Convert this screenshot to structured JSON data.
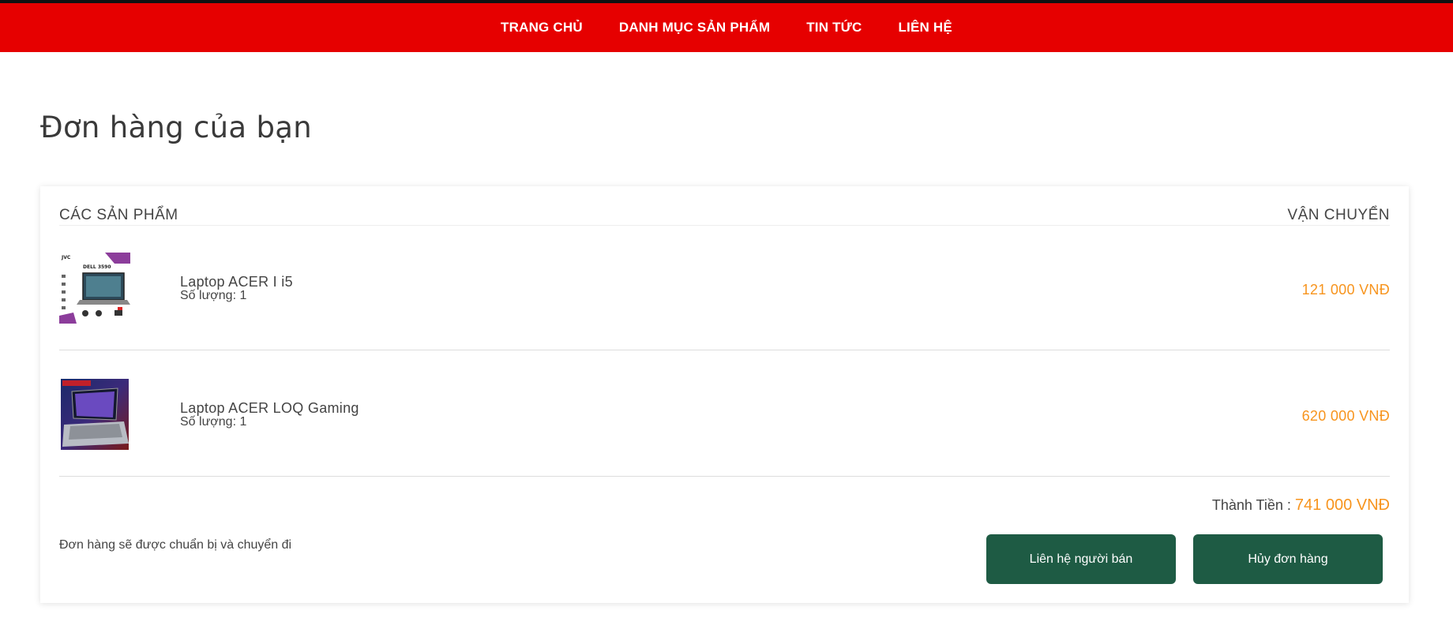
{
  "nav": {
    "items": [
      "TRANG CHỦ",
      "DANH MỤC SẢN PHẨM",
      "TIN TỨC",
      "LIÊN HỆ"
    ]
  },
  "page": {
    "title": "Đơn hàng của bạn"
  },
  "order": {
    "col_products": "CÁC SẢN PHẨM",
    "col_shipping": "VẬN CHUYỂN",
    "items": [
      {
        "name": "Laptop ACER I i5",
        "quantity": "Số lượng: 1",
        "price": "121 000 VNĐ",
        "thumb_icon": "laptop-dell-3590-thumbnail"
      },
      {
        "name": "Laptop ACER LOQ Gaming",
        "quantity": "Số lượng: 1",
        "price": "620 000 VNĐ",
        "thumb_icon": "laptop-gaming-thumbnail"
      }
    ],
    "total_label": "Thành Tiền :",
    "total_value": "741 000 VNĐ",
    "status_note": "Đơn hàng sẽ được chuẩn bị và chuyển đi",
    "contact_button": "Liên hệ người bán",
    "cancel_button": "Hủy đơn hàng"
  },
  "colors": {
    "header_red": "#e60000",
    "price_orange": "#f7941d",
    "button_green": "#1e5b44"
  }
}
